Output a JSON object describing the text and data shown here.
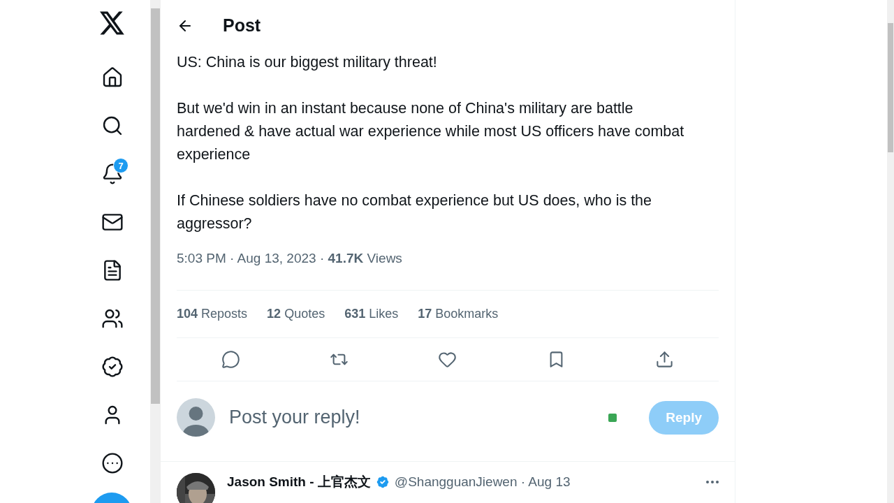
{
  "nav": {
    "notification_badge": "7"
  },
  "header": {
    "title": "Post"
  },
  "post": {
    "paragraphs": [
      "US: China is our biggest military threat!",
      "But we'd win in an instant because none of China's military are battle hardened & have actual war experience while most US officers have combat experience",
      "If Chinese soldiers have no combat experience but US does, who is the aggressor?"
    ],
    "meta": "5:03 PM · Aug 13, 2023 · **41.7K** Views",
    "stats": [
      "**104** Reposts",
      "**12** Quotes",
      "**631** Likes",
      "**17** Bookmarks"
    ]
  },
  "reply_box": {
    "placeholder": "Post your reply!",
    "button": "Reply",
    "button_disabled": true
  },
  "reply": {
    "name": "Jason Smith - 上官杰文",
    "verified": true,
    "handle": "@ShangguanJiewen · Aug 13"
  }
}
